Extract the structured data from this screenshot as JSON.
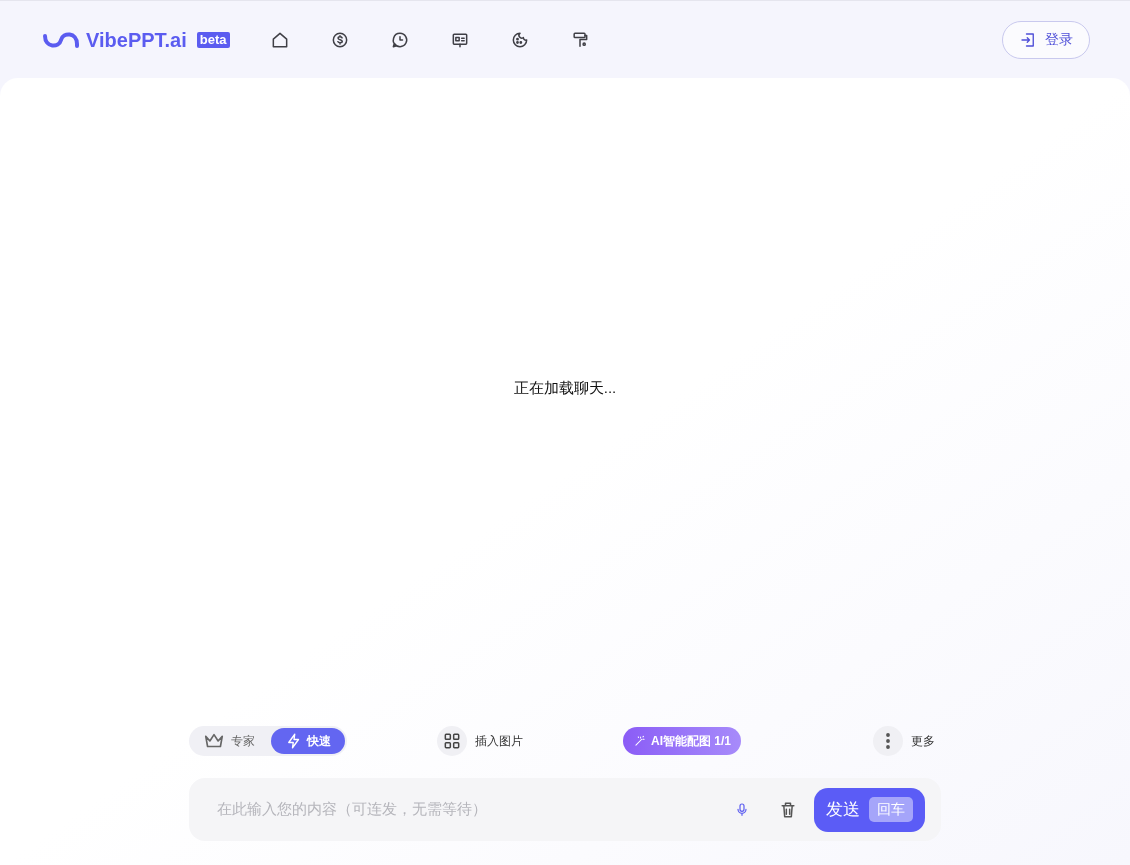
{
  "header": {
    "logo": "VibePPT.ai",
    "badge": "beta",
    "login_button": "登录"
  },
  "main": {
    "loading_text": "正在加载聊天..."
  },
  "toolbar": {
    "modes": [
      {
        "label": "专家",
        "selected": false
      },
      {
        "label": "快速",
        "selected": true
      }
    ],
    "insert_image": "插入图片",
    "ai_image": "AI智能配图 1/1",
    "more": "更多"
  },
  "composer": {
    "placeholder": "在此输入您的内容（可连发，无需等待）",
    "send_button": "发送",
    "send_key": "回车"
  }
}
